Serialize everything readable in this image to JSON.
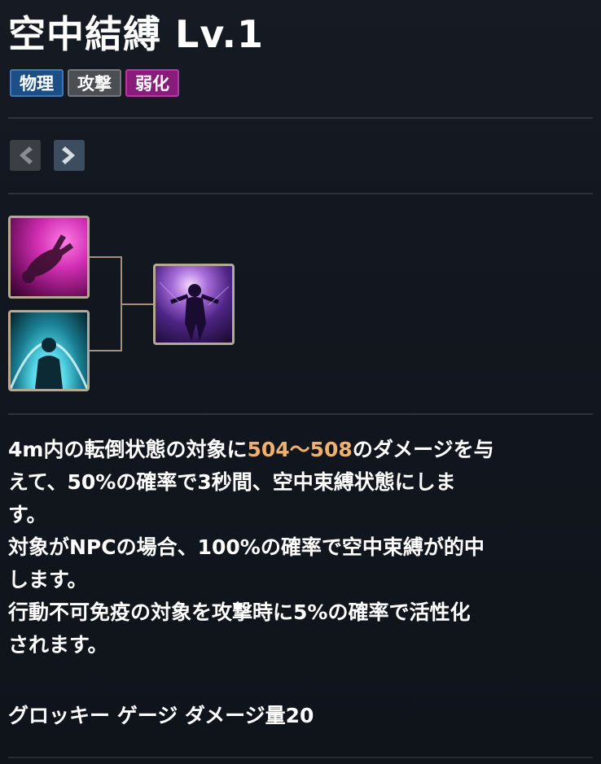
{
  "skill": {
    "title": "空中結縛 Lv.1",
    "tags": [
      "物理",
      "攻撃",
      "弱化"
    ]
  },
  "navigation": {
    "prev_icon": "chevron-left-icon",
    "next_icon": "chevron-right-icon"
  },
  "skill_chain": {
    "icons": [
      "knockdown-skill-icon",
      "barrier-skill-icon",
      "aerial-bind-skill-icon"
    ]
  },
  "description": {
    "line1_pre": "4m内の転倒状態の対象に",
    "damage_range": "504〜508",
    "line1_post": "のダメージを与",
    "rest": "えて、50%の確率で3秒間、空中束縛状態にしま\nす。\n対象がNPCの場合、100%の確率で空中束縛が的中\nします。\n行動不可免疫の対象を攻撃時に5%の確率で活性化\nされます。",
    "groggy": "グロッキー ゲージ ダメージ量20"
  },
  "colors": {
    "tag_physical": "#1d4f86",
    "tag_attack": "#4b4e53",
    "tag_debuff": "#8a1b7a",
    "damage_highlight": "#f0b070"
  }
}
